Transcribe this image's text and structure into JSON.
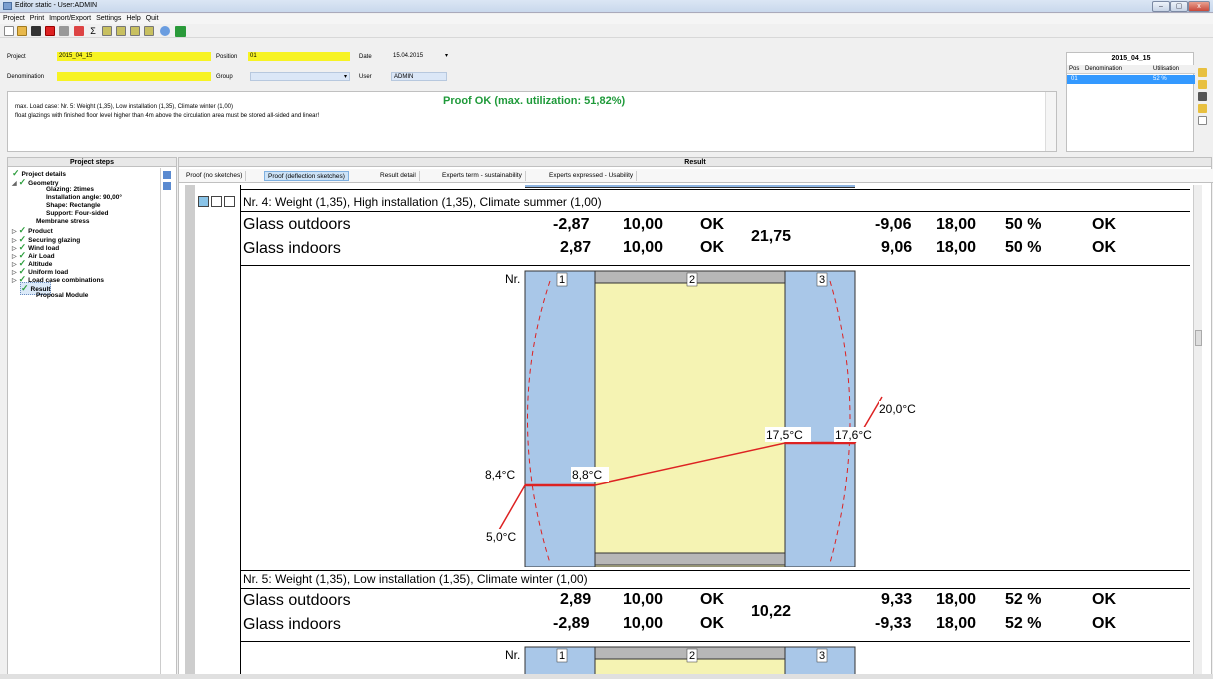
{
  "window": {
    "title": "Editor static - User:ADMIN"
  },
  "menu": [
    "Project",
    "Print",
    "Import/Export",
    "Settings",
    "Help",
    "Quit"
  ],
  "form": {
    "project_label": "Project",
    "project_value": "2015_04_15",
    "position_label": "Position",
    "position_value": "01",
    "date_label": "Date",
    "date_value": "15.04.2015",
    "denomination_label": "Denomination",
    "denomination_value": "",
    "group_label": "Group",
    "group_value": "",
    "user_label": "User",
    "user_value": "ADMIN"
  },
  "message": {
    "status": "Proof OK (max. utilization: 51,82%)",
    "line1": "max. Load case: Nr. 5:  Weight (1,35), Low installation (1,35), Climate winter (1,00)",
    "line2": "float glazings with finished floor level higher than 4m above the circulation area must be stored all-sided and linear!"
  },
  "positions": {
    "title": "2015_04_15",
    "col_pos": "Pos",
    "col_den": "Denomination",
    "col_util": "Utilisation",
    "row_pos": "01",
    "row_den": "",
    "row_util": "52 %"
  },
  "steps": {
    "title": "Project steps",
    "items": [
      {
        "label": "Project details",
        "check": true
      },
      {
        "label": "Geometry",
        "check": true
      },
      {
        "label": "Glazing: 2times",
        "check": false
      },
      {
        "label": "Installation angle: 90,00°",
        "check": false
      },
      {
        "label": "Shape: Rectangle",
        "check": false
      },
      {
        "label": "Support: Four-sided",
        "check": false
      },
      {
        "label": "Membrane stress",
        "check": false
      },
      {
        "label": "Product",
        "check": true
      },
      {
        "label": "Securing glazing",
        "check": true
      },
      {
        "label": "Wind load",
        "check": true
      },
      {
        "label": "Air Load",
        "check": true
      },
      {
        "label": "Altitude",
        "check": true
      },
      {
        "label": "Uniform load",
        "check": true
      },
      {
        "label": "Load case combinations",
        "check": true
      },
      {
        "label": "Result",
        "check": true
      },
      {
        "label": "Proposal Module",
        "check": false
      }
    ]
  },
  "result": {
    "title": "Result",
    "tabs": [
      "Proof (no sketches)",
      "Proof (deflection sketches)",
      "Result detail",
      "Experts term - sustainability",
      "Experts expressed - Usability"
    ],
    "case4": {
      "title": "Nr. 4:  Weight (1,35), High installation (1,35), Climate summer (1,00)",
      "row1": {
        "name": "Glass outdoors",
        "a": "-2,87",
        "b": "10,00",
        "c": "OK",
        "d": "-9,06",
        "e": "18,00",
        "f": "50 %",
        "g": "OK"
      },
      "row2": {
        "name": "Glass indoors",
        "a": "2,87",
        "b": "10,00",
        "c": "OK",
        "d": "9,06",
        "e": "18,00",
        "f": "50 %",
        "g": "OK"
      },
      "mid": "21,75"
    },
    "sketch": {
      "nr": "Nr.",
      "pane1": "1",
      "pane2": "2",
      "pane3": "3",
      "t1": "20,0°C",
      "t2": "17,5°C",
      "t3": "17,6°C",
      "t4": "8,4°C",
      "t5": "8,8°C",
      "t6": "5,0°C"
    },
    "case5": {
      "title": "Nr. 5:  Weight (1,35), Low installation (1,35), Climate winter (1,00)",
      "row1": {
        "name": "Glass outdoors",
        "a": "2,89",
        "b": "10,00",
        "c": "OK",
        "d": "9,33",
        "e": "18,00",
        "f": "52 %",
        "g": "OK"
      },
      "row2": {
        "name": "Glass indoors",
        "a": "-2,89",
        "b": "10,00",
        "c": "OK",
        "d": "-9,33",
        "e": "18,00",
        "f": "52 %",
        "g": "OK"
      },
      "mid": "10,22"
    },
    "sketch2": {
      "nr": "Nr.",
      "pane1": "1",
      "pane2": "2",
      "pane3": "3"
    }
  }
}
